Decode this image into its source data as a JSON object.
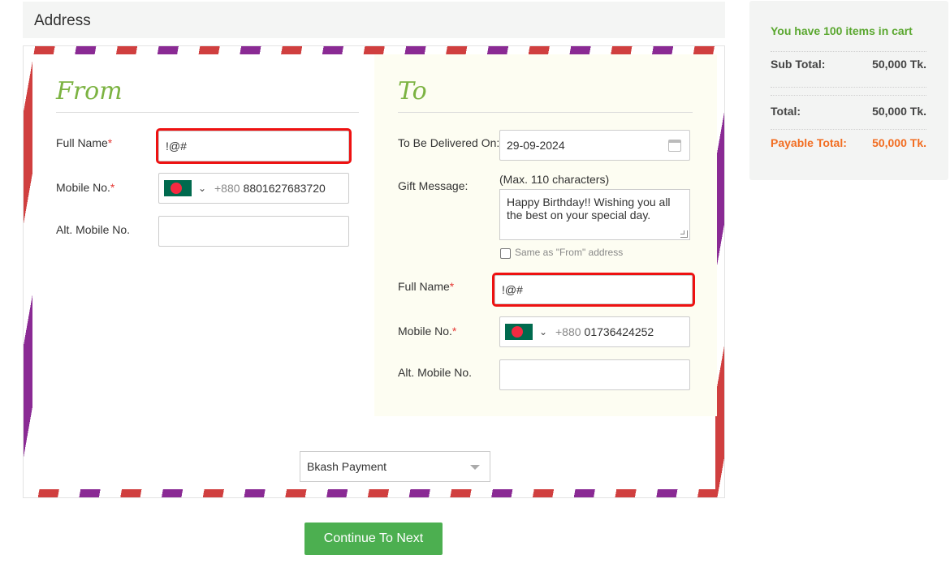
{
  "header": {
    "title": "Address"
  },
  "from": {
    "title": "From",
    "full_name_label": "Full Name",
    "full_name_value": "!@#",
    "mobile_label": "Mobile No.",
    "mobile_dial": "+880",
    "mobile_value": "8801627683720",
    "alt_mobile_label": "Alt. Mobile No.",
    "alt_mobile_value": "",
    "required_mark": "*"
  },
  "to": {
    "title": "To",
    "delivery_label": "To Be Delivered On:",
    "delivery_value": "29-09-2024",
    "gift_label": "Gift Message:",
    "gift_hint": "(Max. 110 characters)",
    "gift_value": "Happy Birthday!! Wishing you all the best on your special day.",
    "same_as_label": "Same as \"From\" address",
    "full_name_label": "Full Name",
    "full_name_value": "!@#",
    "mobile_label": "Mobile No.",
    "mobile_dial": "+880",
    "mobile_value": "01736424252",
    "alt_mobile_label": "Alt. Mobile No.",
    "alt_mobile_value": "",
    "required_mark": "*"
  },
  "payment": {
    "selected": "Bkash Payment"
  },
  "actions": {
    "continue_label": "Continue To Next"
  },
  "summary": {
    "note": "You have 100 items in cart",
    "sub_total_label": "Sub Total:",
    "sub_total_value": "50,000 Tk.",
    "total_label": "Total:",
    "total_value": "50,000 Tk.",
    "payable_label": "Payable Total:",
    "payable_value": "50,000 Tk."
  },
  "colors": {
    "accent_green": "#4caf50",
    "title_green": "#7cb342",
    "error_red": "#ee1111",
    "payable_orange": "#f26d21",
    "stripe_red": "#d03f3f",
    "stripe_purple": "#8a2a94"
  },
  "icons": [
    "bangladesh-flag-icon",
    "chevron-down-icon",
    "calendar-icon",
    "caret-down-icon",
    "resize-handle-icon"
  ]
}
